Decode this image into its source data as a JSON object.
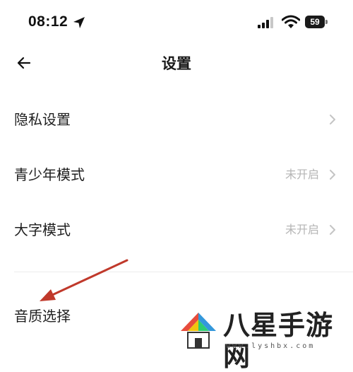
{
  "status_bar": {
    "time": "08:12",
    "battery": "59",
    "icons": [
      "location-arrow-icon",
      "signal-icon",
      "wifi-icon",
      "battery-icon"
    ]
  },
  "header": {
    "title": "设置",
    "back_icon": "arrow-left-icon"
  },
  "settings": {
    "items": [
      {
        "label": "隐私设置",
        "value": ""
      },
      {
        "label": "青少年模式",
        "value": "未开启"
      },
      {
        "label": "大字模式",
        "value": "未开启"
      },
      {
        "label": "音质选择",
        "value": ""
      }
    ]
  },
  "watermark": {
    "brand": "八星手游网",
    "url": "www.lyshbx.com"
  },
  "colors": {
    "annotation_arrow": "#c0392b",
    "secondary_text": "#b5b5b5",
    "divider": "#ececec"
  }
}
